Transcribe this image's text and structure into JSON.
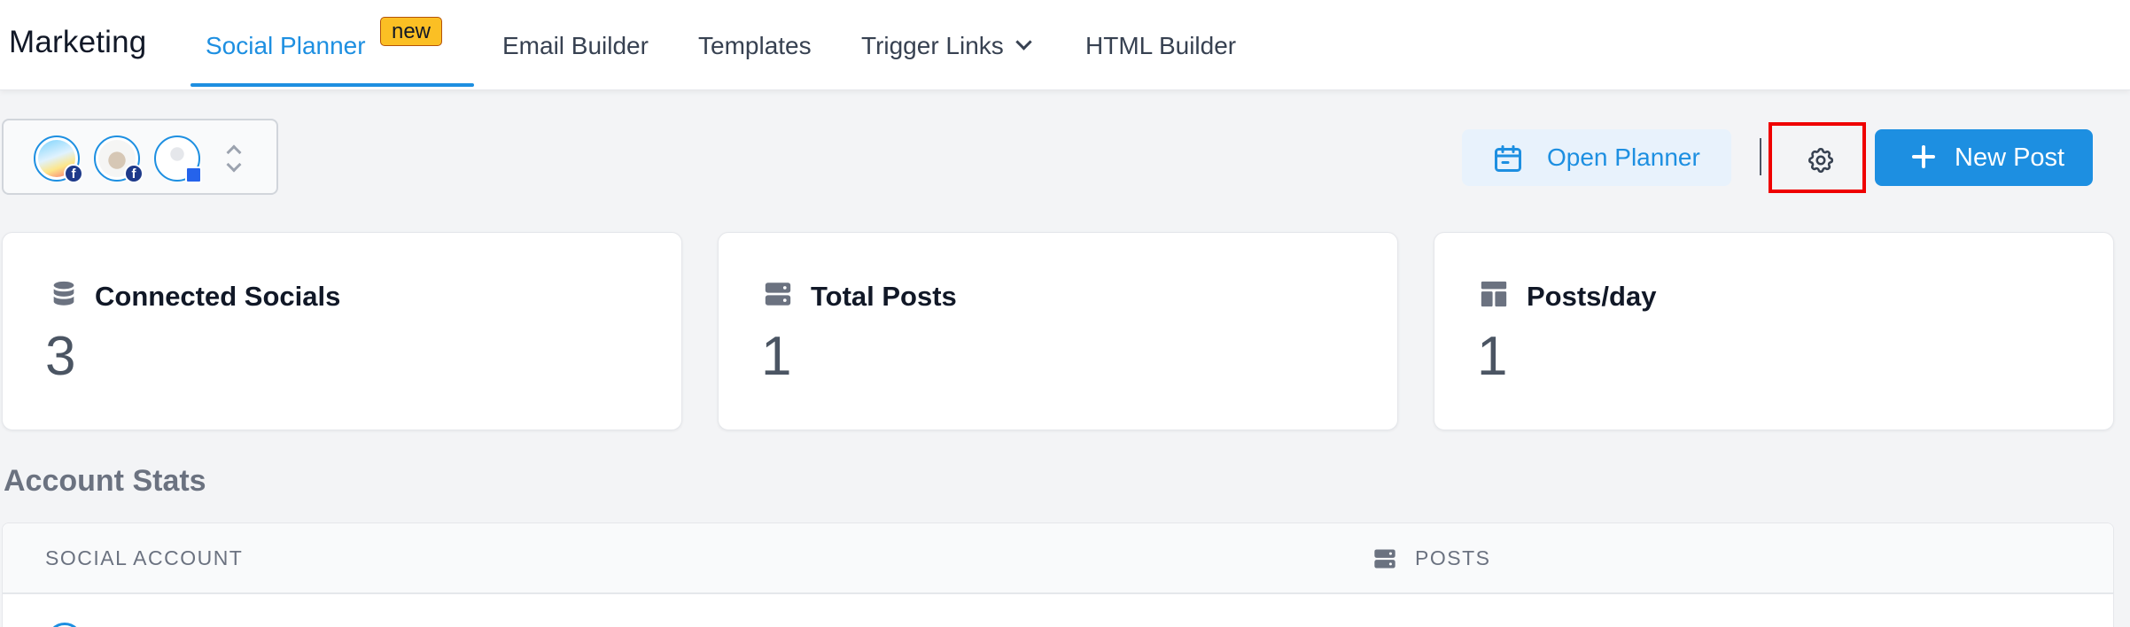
{
  "app": {
    "title": "Marketing"
  },
  "nav": {
    "tabs": [
      {
        "label": "Social Planner",
        "badge": "new",
        "active": true
      },
      {
        "label": "Email Builder"
      },
      {
        "label": "Templates"
      },
      {
        "label": "Trigger Links",
        "has_dropdown": true
      },
      {
        "label": "HTML Builder"
      }
    ]
  },
  "accounts": {
    "avatars": [
      {
        "name": "facebook-account-1",
        "platform": "facebook"
      },
      {
        "name": "facebook-account-2",
        "platform": "facebook"
      },
      {
        "name": "google-business-account",
        "platform": "google-my-business"
      }
    ],
    "badge_glyph": "f"
  },
  "actions": {
    "open_planner": "Open Planner",
    "new_post": "New Post",
    "settings_icon": "gear-icon"
  },
  "stats": [
    {
      "icon": "database-icon",
      "title": "Connected Socials",
      "value": "3"
    },
    {
      "icon": "server-icon",
      "title": "Total Posts",
      "value": "1"
    },
    {
      "icon": "layout-icon",
      "title": "Posts/day",
      "value": "1"
    }
  ],
  "account_stats": {
    "title": "Account Stats",
    "columns": [
      "SOCIAL ACCOUNT",
      "POSTS"
    ]
  },
  "colors": {
    "accent": "#1d8fe1",
    "badge": "#fbbf24",
    "highlight": "#ef0000"
  }
}
